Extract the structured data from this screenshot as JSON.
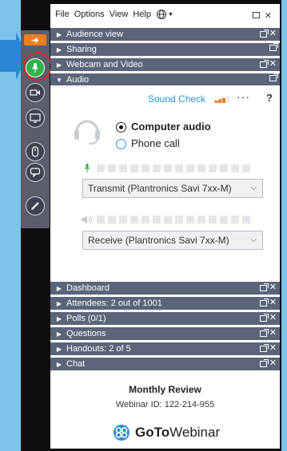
{
  "menubar": {
    "items": [
      "File",
      "Options",
      "View",
      "Help"
    ],
    "globe_icon": "globe-icon"
  },
  "panels_top": [
    {
      "label": "Audience view"
    },
    {
      "label": "Sharing"
    },
    {
      "label": "Webcam and Video"
    },
    {
      "label": "Audio"
    }
  ],
  "audio": {
    "sound_check": "Sound Check",
    "more": "···",
    "help": "?",
    "option_computer": "Computer audio",
    "option_phone": "Phone call",
    "selected": "Computer audio",
    "transmit": "Transmit (Plantronics Savi 7xx-M)",
    "receive": "Receive (Plantronics Savi 7xx-M)"
  },
  "panels_bottom": [
    {
      "label": "Dashboard"
    },
    {
      "label": "Attendees:  2 out of 1001"
    },
    {
      "label": "Polls (0/1)"
    },
    {
      "label": "Questions"
    },
    {
      "label": "Handouts: 2 of 5"
    },
    {
      "label": "Chat"
    }
  ],
  "footer": {
    "title": "Monthly Review",
    "webinar_id": "Webinar ID: 122-214-955",
    "logo_bold": "GoTo",
    "logo_regular": "Webinar"
  },
  "colors": {
    "background": "#7cc4ea",
    "panel_bar": "#5b6479",
    "accent_blue": "#2f8fd8",
    "accent_orange": "#f07d22",
    "mic_green": "#2db34a",
    "highlight_red": "#d9262c"
  }
}
